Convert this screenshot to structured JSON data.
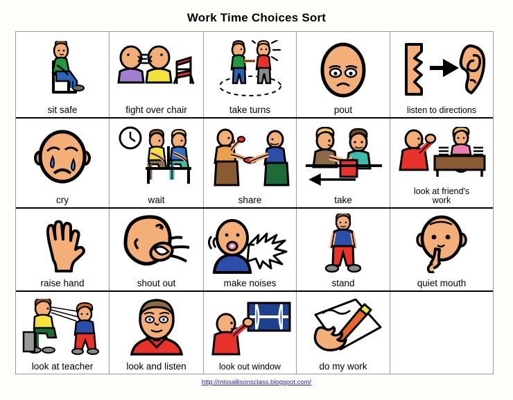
{
  "page": {
    "title": "Work Time Choices Sort",
    "footer_link": "http://missallisonsclass.blogspot.com/"
  },
  "colors": {
    "skin": "#f4ae78",
    "skin_shadow": "#e09a62",
    "outline": "#000000",
    "link": "#2222cc",
    "grid_outer_border": "#999999",
    "grid_row_divider": "#000000",
    "grid_col_divider": "#9a9a9a",
    "page_background": "#fdfdfa",
    "cell_background": "#ffffff",
    "green_shirt": "#1f9a3c",
    "blue_jeans": "#2b62b5",
    "purple_shirt": "#9f7fd0",
    "yellow_shirt": "#f2e23a",
    "red": "#e8322a",
    "blue_shirt": "#1f4fa8",
    "teal": "#3fb9a8",
    "brown": "#8a5a32",
    "gray": "#9a9a9a",
    "tear_blue": "#2b7fd4",
    "dark_green": "#1d6b35",
    "hair_brown": "#8a5a32",
    "hair_blonde": "#f0c659",
    "pink": "#e87fb0",
    "orange_pencil": "#e8682a",
    "window_blue": "#1f3f8f"
  },
  "grid": {
    "rows": [
      {
        "cells": [
          {
            "label": "sit safe",
            "icon": "person-sitting-on-chair-icon",
            "empty": false
          },
          {
            "label": "fight over chair",
            "icon": "two-people-arguing-over-chair-icon",
            "empty": false
          },
          {
            "label": "take turns",
            "icon": "two-people-taking-turns-icon",
            "empty": false
          },
          {
            "label": "pout",
            "icon": "pouting-face-icon",
            "empty": false
          },
          {
            "label": "listen to directions",
            "icon": "face-profile-arrow-ear-icon",
            "empty": false
          }
        ]
      },
      {
        "cells": [
          {
            "label": "cry",
            "icon": "crying-face-icon",
            "empty": false
          },
          {
            "label": "wait",
            "icon": "two-people-waiting-with-clock-icon",
            "empty": false
          },
          {
            "label": "share",
            "icon": "person-sharing-food-icon",
            "empty": false
          },
          {
            "label": "take",
            "icon": "person-taking-object-icon",
            "empty": false
          },
          {
            "label": "look at friend's\nwork",
            "icon": "person-looking-at-friends-work-icon",
            "empty": false
          }
        ]
      },
      {
        "cells": [
          {
            "label": "raise hand",
            "icon": "raised-hand-icon",
            "empty": false
          },
          {
            "label": "shout out",
            "icon": "face-shouting-icon",
            "empty": false
          },
          {
            "label": "make noises",
            "icon": "person-making-noises-icon",
            "empty": false
          },
          {
            "label": "stand",
            "icon": "person-standing-icon",
            "empty": false
          },
          {
            "label": "quiet mouth",
            "icon": "finger-to-lips-quiet-icon",
            "empty": false
          }
        ]
      },
      {
        "cells": [
          {
            "label": "look at teacher",
            "icon": "student-looking-at-teacher-icon",
            "empty": false
          },
          {
            "label": "look and listen",
            "icon": "attentive-face-icon",
            "empty": false
          },
          {
            "label": "look out window",
            "icon": "person-looking-out-window-icon",
            "empty": false
          },
          {
            "label": "do my work",
            "icon": "hand-writing-with-pencil-icon",
            "empty": false
          },
          {
            "label": "",
            "icon": "",
            "empty": true
          }
        ]
      }
    ]
  }
}
